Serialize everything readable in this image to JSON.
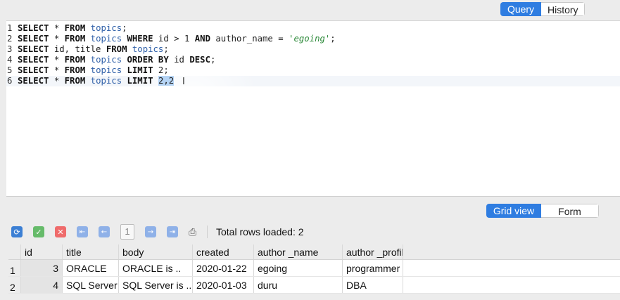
{
  "tabs": {
    "query_label": "Query",
    "history_label": "History"
  },
  "editor": {
    "lines": [
      {
        "n": "1",
        "tokens": [
          [
            "kw",
            "SELECT"
          ],
          [
            "t",
            " * "
          ],
          [
            "kw",
            "FROM"
          ],
          [
            "t",
            " "
          ],
          [
            "tbl",
            "topics"
          ],
          [
            "t",
            ";"
          ]
        ]
      },
      {
        "n": "2",
        "tokens": [
          [
            "kw",
            "SELECT"
          ],
          [
            "t",
            " * "
          ],
          [
            "kw",
            "FROM"
          ],
          [
            "t",
            " "
          ],
          [
            "tbl",
            "topics"
          ],
          [
            "t",
            " "
          ],
          [
            "kw",
            "WHERE"
          ],
          [
            "t",
            " id > 1 "
          ],
          [
            "kw",
            "AND"
          ],
          [
            "t",
            " author_name = "
          ],
          [
            "str",
            "'egoing'"
          ],
          [
            "t",
            ";"
          ]
        ]
      },
      {
        "n": "3",
        "tokens": [
          [
            "kw",
            "SELECT"
          ],
          [
            "t",
            " id, title "
          ],
          [
            "kw",
            "FROM"
          ],
          [
            "t",
            " "
          ],
          [
            "tbl",
            "topics"
          ],
          [
            "t",
            ";"
          ]
        ]
      },
      {
        "n": "4",
        "tokens": [
          [
            "kw",
            "SELECT"
          ],
          [
            "t",
            " * "
          ],
          [
            "kw",
            "FROM"
          ],
          [
            "t",
            " "
          ],
          [
            "tbl",
            "topics"
          ],
          [
            "t",
            " "
          ],
          [
            "kw",
            "ORDER BY"
          ],
          [
            "t",
            " id "
          ],
          [
            "kw",
            "DESC"
          ],
          [
            "t",
            ";"
          ]
        ]
      },
      {
        "n": "5",
        "tokens": [
          [
            "kw",
            "SELECT"
          ],
          [
            "t",
            " * "
          ],
          [
            "kw",
            "FROM"
          ],
          [
            "t",
            " "
          ],
          [
            "tbl",
            "topics"
          ],
          [
            "t",
            " "
          ],
          [
            "kw",
            "LIMIT"
          ],
          [
            "t",
            " 2;"
          ]
        ]
      },
      {
        "n": "6",
        "tokens": [
          [
            "kw",
            "SELECT"
          ],
          [
            "t",
            " * "
          ],
          [
            "kw",
            "FROM"
          ],
          [
            "t",
            " "
          ],
          [
            "tbl",
            "topics"
          ],
          [
            "t",
            " "
          ],
          [
            "kw",
            "LIMIT"
          ],
          [
            "t",
            " "
          ],
          [
            "sel",
            "2,2"
          ]
        ]
      }
    ]
  },
  "view_tabs": {
    "grid_label": "Grid view",
    "form_label": "Form view"
  },
  "toolbar": {
    "page_number": "1",
    "total_rows_text": "Total rows loaded: 2"
  },
  "grid": {
    "columns": [
      "id",
      "title",
      "body",
      "created",
      "author _name",
      "author _profil"
    ],
    "rows": [
      {
        "row_num": "1",
        "cells": [
          "3",
          "ORACLE",
          "ORACLE is ..",
          "2020-01-22",
          "egoing",
          "programmer"
        ]
      },
      {
        "row_num": "2",
        "cells": [
          "4",
          "SQL Server",
          "SQL Server is ..",
          "2020-01-03",
          "duru",
          "DBA"
        ]
      }
    ]
  },
  "colors": {
    "accent": "#2f7de1",
    "keyword": "#111111",
    "table_name": "#2e5fa8",
    "string": "#2d8a3a",
    "selection": "#b5d4f5"
  },
  "icons": [
    "refresh-icon",
    "commit-check-icon",
    "rollback-x-icon",
    "first-page-icon",
    "prev-page-icon",
    "next-page-icon",
    "last-page-icon",
    "print-icon"
  ]
}
